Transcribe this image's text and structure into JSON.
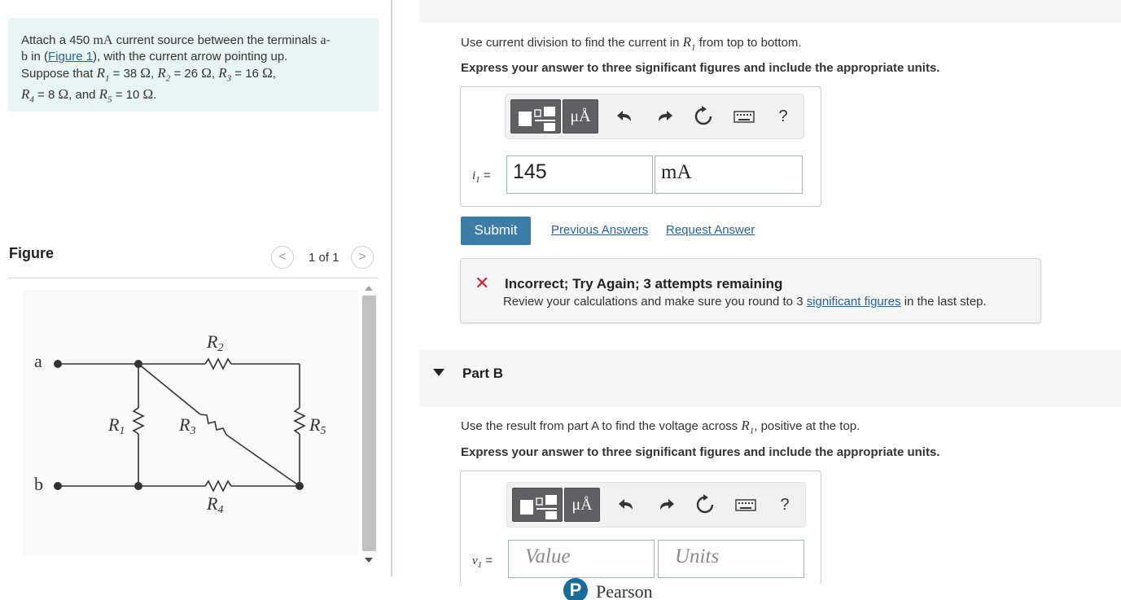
{
  "problem": {
    "text_1": "Attach a 450 ",
    "current_unit": "mA",
    "text_2": " current source between the terminals ",
    "terminal_a": "a",
    "dash": "-",
    "terminal_b": "b",
    "text_3": " in (",
    "figure_link": "Figure 1",
    "text_4": "), with the current arrow pointing up.",
    "text_5": "Suppose that ",
    "R1": "R",
    "R1_sub": "1",
    "R1_value": " = 38  ",
    "R2": "R",
    "R2_sub": "2",
    "R2_value": " = 26  ",
    "R3": "R",
    "R3_sub": "3",
    "R3_value": " = 16  ",
    "R4": "R",
    "R4_sub": "4",
    "R4_value": " = 8  ",
    "R5": "R",
    "R5_sub": "5",
    "R5_value": " = 10  ",
    "ohm": "Ω",
    "comma": ", ",
    "and": ", and ",
    "period": "."
  },
  "figure": {
    "label": "Figure",
    "counter": "1 of 1",
    "prev_glyph": "<",
    "next_glyph": ">",
    "circuit": {
      "terminal_a": "a",
      "terminal_b": "b",
      "R1": "R",
      "R1_sub": "1",
      "R2": "R",
      "R2_sub": "2",
      "R3": "R",
      "R3_sub": "3",
      "R4": "R",
      "R4_sub": "4",
      "R5": "R",
      "R5_sub": "5"
    }
  },
  "partA": {
    "instruction_1": "Use current division to find the current in ",
    "instruction_R": "R",
    "instruction_sub": "1",
    "instruction_2": " from top to bottom.",
    "instruction_bold": "Express your answer to three significant figures and include the appropriate units.",
    "toolbar": {
      "units_label": "μÅ",
      "help_label": "?"
    },
    "var_name": "i",
    "var_sub": "1",
    "equals": " =",
    "value": "145",
    "units": "mA",
    "submit_label": "Submit",
    "previous_answers": "Previous Answers",
    "request_answer": "Request Answer"
  },
  "feedback": {
    "icon": "✕",
    "title": "Incorrect; Try Again; 3 attempts remaining",
    "detail_1": "Review your calculations and make sure you round to 3 ",
    "detail_link": "significant figures",
    "detail_2": " in the last step."
  },
  "partB": {
    "title": "Part B",
    "instruction_1": "Use the result from part A to find the voltage across ",
    "instruction_R": "R",
    "instruction_sub": "1",
    "instruction_2": ", positive at the top.",
    "instruction_bold": "Express your answer to three significant figures and include the appropriate units.",
    "toolbar": {
      "units_label": "μÅ",
      "help_label": "?"
    },
    "var_name": "v",
    "var_sub": "1",
    "equals": " =",
    "value_placeholder": "Value",
    "units_placeholder": "Units"
  },
  "footer": {
    "logo_letter": "P",
    "brand": "Pearson"
  },
  "colors": {
    "accent": "#3d7ca6",
    "problem_bg": "#e9f4f4",
    "error": "#d2232a"
  }
}
